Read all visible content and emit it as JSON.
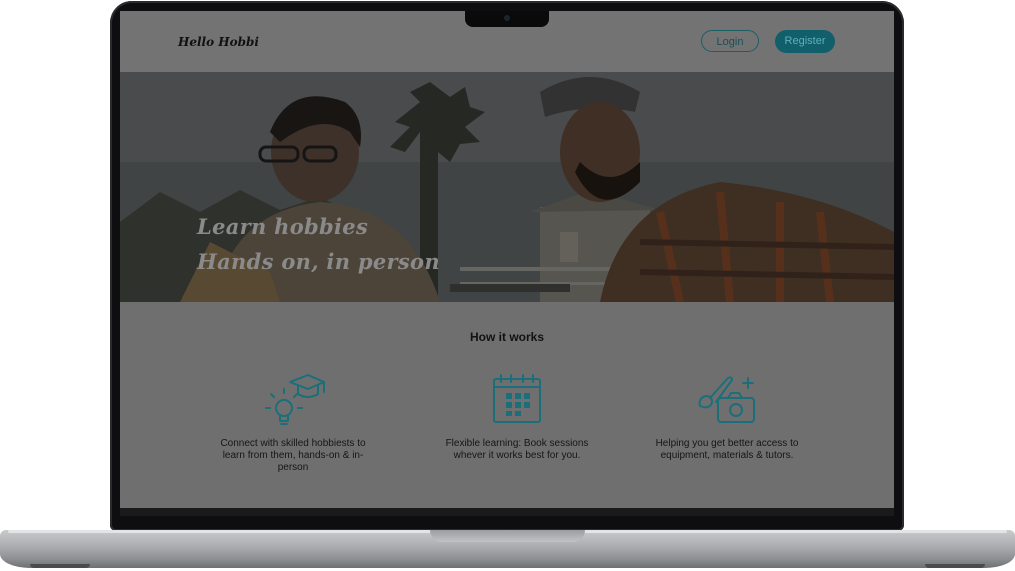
{
  "site": {
    "logo": "Hello Hobbi",
    "nav": {
      "login_label": "Login",
      "register_label": "Register"
    }
  },
  "hero": {
    "line1": "Learn hobbies",
    "line2": "Hands on, in person"
  },
  "how_it_works": {
    "title": "How it works",
    "features": [
      {
        "icon": "graduation-cap-lightbulb-icon",
        "text": "Connect with skilled hobbiests to learn from them, hands-on & in-person"
      },
      {
        "icon": "calendar-icon",
        "text": "Flexible learning: Book sessions whever it works best for you."
      },
      {
        "icon": "paintbrush-camera-icon",
        "text": "Helping you get better access to equipment, materials & tutors."
      }
    ]
  },
  "colors": {
    "accent": "#105f6a",
    "icon_teal": "#1a6f7b"
  }
}
